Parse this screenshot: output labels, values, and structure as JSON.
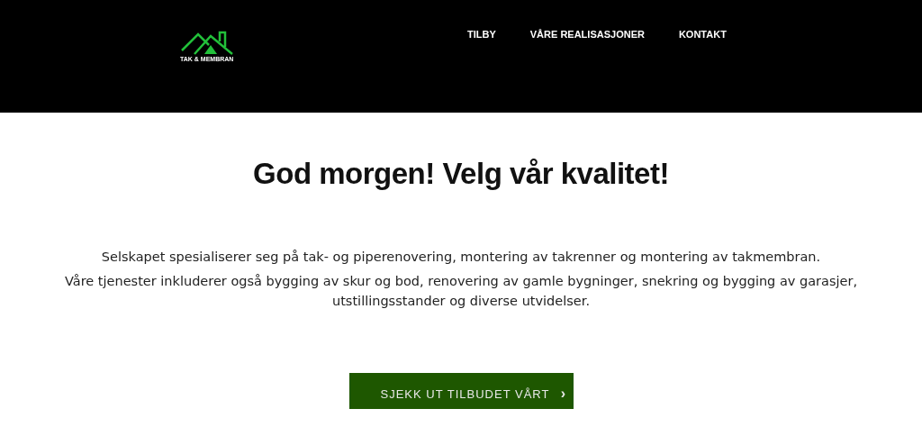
{
  "logo": {
    "text": "TAK & MEMBRAN"
  },
  "nav": [
    {
      "label": "TILBY"
    },
    {
      "label": "VÅRE REALISASJONER"
    },
    {
      "label": "KONTAKT"
    }
  ],
  "heading": {
    "text": "God morgen! **Velg vår kvalitet!**"
  },
  "paragraphs": [
    "Selskapet spesialiserer seg på tak- og piperenovering, montering av takrenner og montering av takmembran.",
    "Våre tjenester inkluderer også bygging av skur og bod, renovering av gamle bygninger, snekring og bygging av garasjer, utstillingsstander og diverse utvidelser."
  ],
  "cta": {
    "label": "SJEKK UT TILBUDET VÅRT",
    "arrow": "›"
  }
}
